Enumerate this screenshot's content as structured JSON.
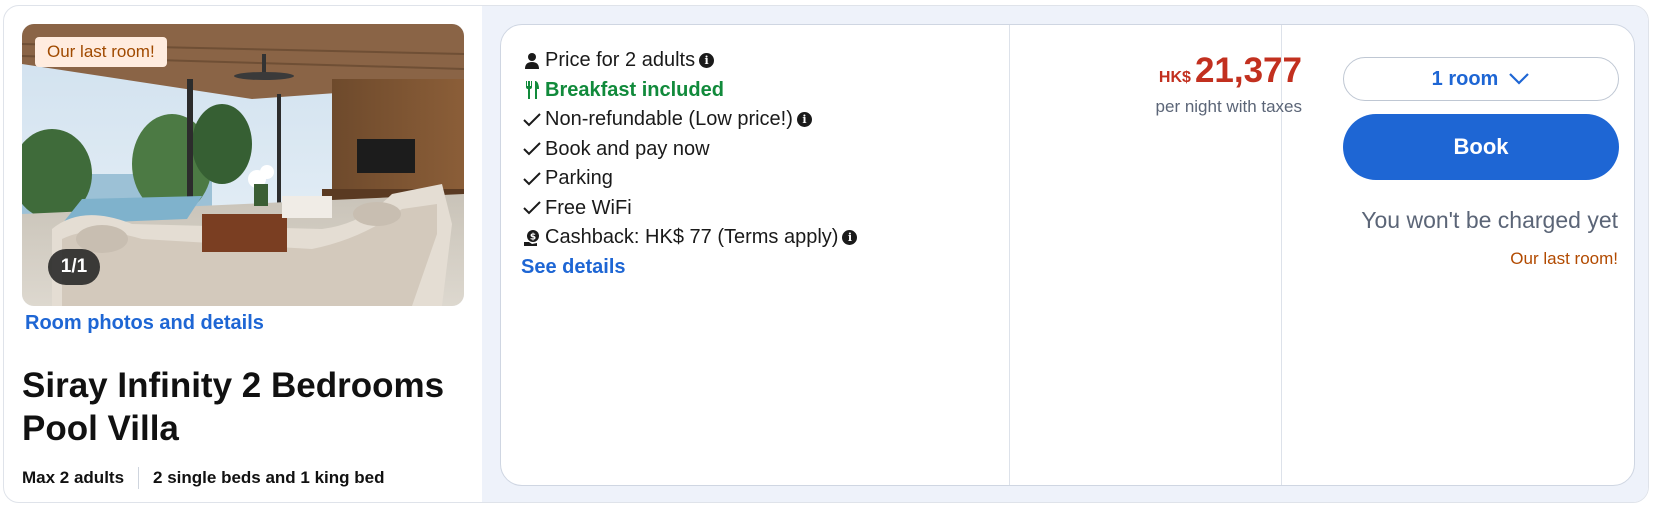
{
  "room": {
    "badge": "Our last room!",
    "photo_counter": "1/1",
    "photos_link": "Room photos and details",
    "title": "Siray Infinity 2 Bedrooms Pool Villa",
    "max_guests": "Max 2 adults",
    "beds": "2 single beds and 1 king bed"
  },
  "features": {
    "price_for": "Price for 2 adults",
    "breakfast": "Breakfast included",
    "refund": "Non-refundable (Low price!)",
    "pay": "Book and pay now",
    "parking": "Parking",
    "wifi": "Free WiFi",
    "cashback": "Cashback: HK$ 77 (Terms apply)",
    "see_details": "See details",
    "info_glyph": "i"
  },
  "price": {
    "currency": "HK$",
    "amount": "21,377",
    "note": "per night with taxes"
  },
  "booking": {
    "room_select": "1 room",
    "book_label": "Book",
    "charged_note": "You won't be charged yet",
    "last_room": "Our last room!"
  },
  "colors": {
    "accent_blue": "#1e66d4",
    "price_red": "#c2301f",
    "breakfast_green": "#118a3b",
    "warning_orange": "#b24a00",
    "badge_bg": "#ffecdf"
  },
  "icons": [
    "person-icon",
    "fork-knife-icon",
    "check-icon",
    "info-icon",
    "cashback-icon",
    "chevron-down-icon"
  ]
}
